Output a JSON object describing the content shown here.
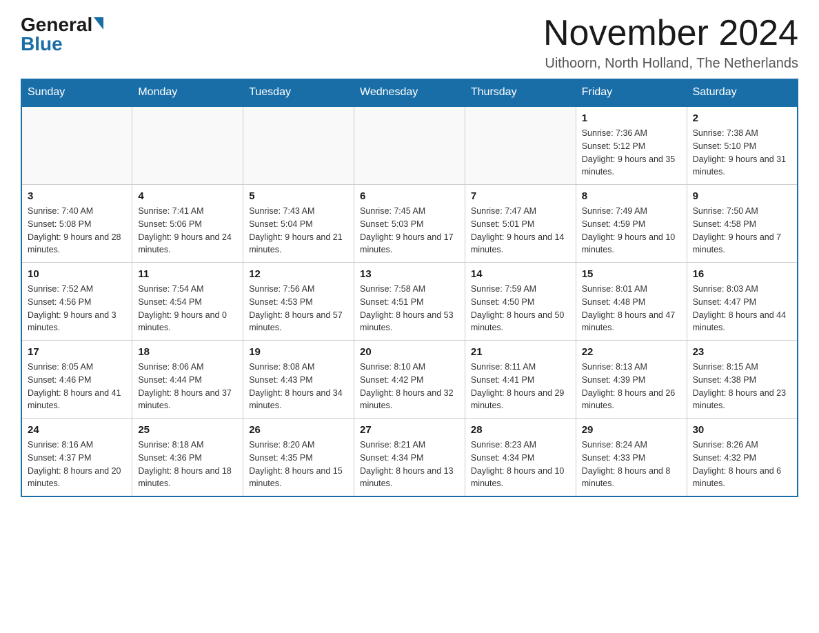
{
  "header": {
    "logo_general": "General",
    "logo_blue": "Blue",
    "month_title": "November 2024",
    "location": "Uithoorn, North Holland, The Netherlands"
  },
  "calendar": {
    "days_of_week": [
      "Sunday",
      "Monday",
      "Tuesday",
      "Wednesday",
      "Thursday",
      "Friday",
      "Saturday"
    ],
    "weeks": [
      [
        {
          "day": "",
          "info": ""
        },
        {
          "day": "",
          "info": ""
        },
        {
          "day": "",
          "info": ""
        },
        {
          "day": "",
          "info": ""
        },
        {
          "day": "",
          "info": ""
        },
        {
          "day": "1",
          "info": "Sunrise: 7:36 AM\nSunset: 5:12 PM\nDaylight: 9 hours and 35 minutes."
        },
        {
          "day": "2",
          "info": "Sunrise: 7:38 AM\nSunset: 5:10 PM\nDaylight: 9 hours and 31 minutes."
        }
      ],
      [
        {
          "day": "3",
          "info": "Sunrise: 7:40 AM\nSunset: 5:08 PM\nDaylight: 9 hours and 28 minutes."
        },
        {
          "day": "4",
          "info": "Sunrise: 7:41 AM\nSunset: 5:06 PM\nDaylight: 9 hours and 24 minutes."
        },
        {
          "day": "5",
          "info": "Sunrise: 7:43 AM\nSunset: 5:04 PM\nDaylight: 9 hours and 21 minutes."
        },
        {
          "day": "6",
          "info": "Sunrise: 7:45 AM\nSunset: 5:03 PM\nDaylight: 9 hours and 17 minutes."
        },
        {
          "day": "7",
          "info": "Sunrise: 7:47 AM\nSunset: 5:01 PM\nDaylight: 9 hours and 14 minutes."
        },
        {
          "day": "8",
          "info": "Sunrise: 7:49 AM\nSunset: 4:59 PM\nDaylight: 9 hours and 10 minutes."
        },
        {
          "day": "9",
          "info": "Sunrise: 7:50 AM\nSunset: 4:58 PM\nDaylight: 9 hours and 7 minutes."
        }
      ],
      [
        {
          "day": "10",
          "info": "Sunrise: 7:52 AM\nSunset: 4:56 PM\nDaylight: 9 hours and 3 minutes."
        },
        {
          "day": "11",
          "info": "Sunrise: 7:54 AM\nSunset: 4:54 PM\nDaylight: 9 hours and 0 minutes."
        },
        {
          "day": "12",
          "info": "Sunrise: 7:56 AM\nSunset: 4:53 PM\nDaylight: 8 hours and 57 minutes."
        },
        {
          "day": "13",
          "info": "Sunrise: 7:58 AM\nSunset: 4:51 PM\nDaylight: 8 hours and 53 minutes."
        },
        {
          "day": "14",
          "info": "Sunrise: 7:59 AM\nSunset: 4:50 PM\nDaylight: 8 hours and 50 minutes."
        },
        {
          "day": "15",
          "info": "Sunrise: 8:01 AM\nSunset: 4:48 PM\nDaylight: 8 hours and 47 minutes."
        },
        {
          "day": "16",
          "info": "Sunrise: 8:03 AM\nSunset: 4:47 PM\nDaylight: 8 hours and 44 minutes."
        }
      ],
      [
        {
          "day": "17",
          "info": "Sunrise: 8:05 AM\nSunset: 4:46 PM\nDaylight: 8 hours and 41 minutes."
        },
        {
          "day": "18",
          "info": "Sunrise: 8:06 AM\nSunset: 4:44 PM\nDaylight: 8 hours and 37 minutes."
        },
        {
          "day": "19",
          "info": "Sunrise: 8:08 AM\nSunset: 4:43 PM\nDaylight: 8 hours and 34 minutes."
        },
        {
          "day": "20",
          "info": "Sunrise: 8:10 AM\nSunset: 4:42 PM\nDaylight: 8 hours and 32 minutes."
        },
        {
          "day": "21",
          "info": "Sunrise: 8:11 AM\nSunset: 4:41 PM\nDaylight: 8 hours and 29 minutes."
        },
        {
          "day": "22",
          "info": "Sunrise: 8:13 AM\nSunset: 4:39 PM\nDaylight: 8 hours and 26 minutes."
        },
        {
          "day": "23",
          "info": "Sunrise: 8:15 AM\nSunset: 4:38 PM\nDaylight: 8 hours and 23 minutes."
        }
      ],
      [
        {
          "day": "24",
          "info": "Sunrise: 8:16 AM\nSunset: 4:37 PM\nDaylight: 8 hours and 20 minutes."
        },
        {
          "day": "25",
          "info": "Sunrise: 8:18 AM\nSunset: 4:36 PM\nDaylight: 8 hours and 18 minutes."
        },
        {
          "day": "26",
          "info": "Sunrise: 8:20 AM\nSunset: 4:35 PM\nDaylight: 8 hours and 15 minutes."
        },
        {
          "day": "27",
          "info": "Sunrise: 8:21 AM\nSunset: 4:34 PM\nDaylight: 8 hours and 13 minutes."
        },
        {
          "day": "28",
          "info": "Sunrise: 8:23 AM\nSunset: 4:34 PM\nDaylight: 8 hours and 10 minutes."
        },
        {
          "day": "29",
          "info": "Sunrise: 8:24 AM\nSunset: 4:33 PM\nDaylight: 8 hours and 8 minutes."
        },
        {
          "day": "30",
          "info": "Sunrise: 8:26 AM\nSunset: 4:32 PM\nDaylight: 8 hours and 6 minutes."
        }
      ]
    ]
  }
}
